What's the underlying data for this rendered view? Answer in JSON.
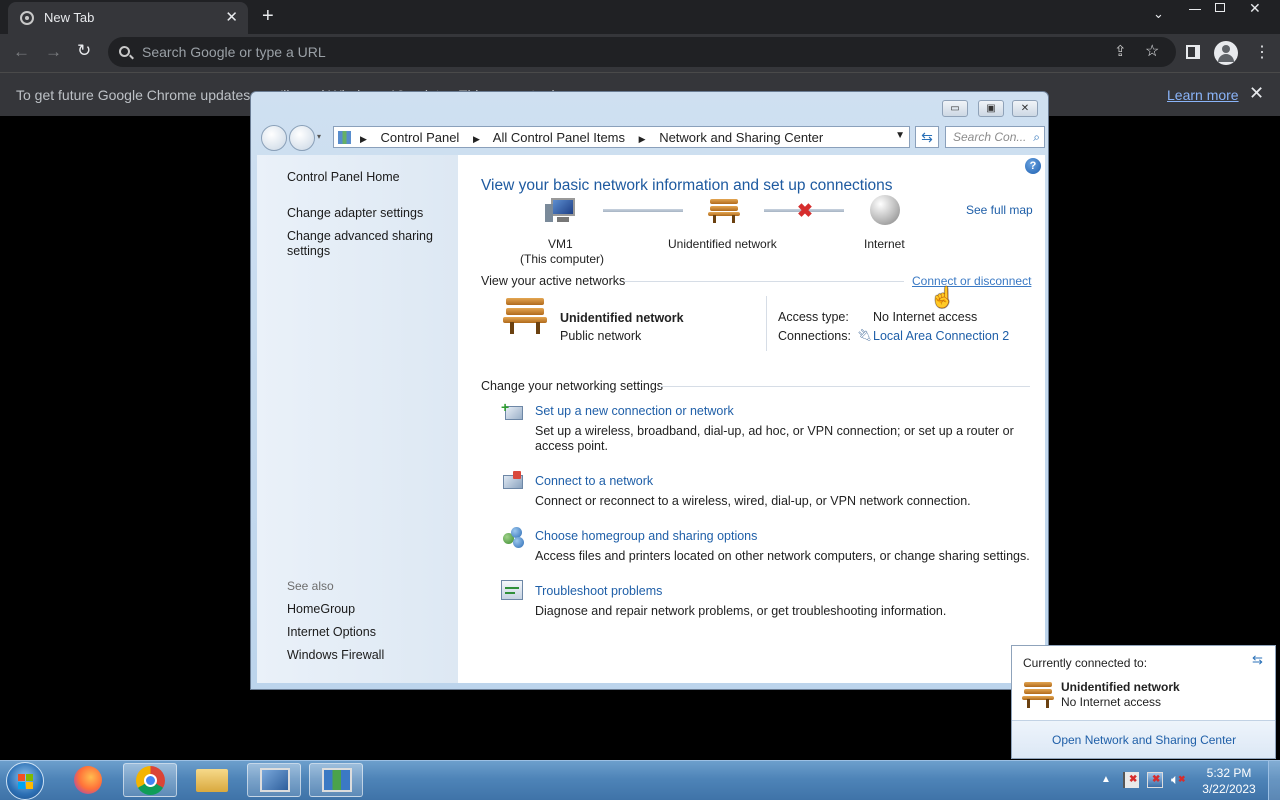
{
  "browser": {
    "tab_title": "New Tab",
    "omnibox_placeholder": "Search Google or type a URL",
    "infobar_message": "To get future Google Chrome updates, you'll need Windows 10 or later. This computer is using Windows 7.",
    "infobar_link": "Learn more"
  },
  "window": {
    "breadcrumbs": [
      "Control Panel",
      "All Control Panel Items",
      "Network and Sharing Center"
    ],
    "search_placeholder": "Search Con..."
  },
  "sidebar": {
    "home": "Control Panel Home",
    "links": [
      "Change adapter settings",
      "Change advanced sharing settings"
    ],
    "see_also_label": "See also",
    "see_also": [
      "HomeGroup",
      "Internet Options",
      "Windows Firewall"
    ]
  },
  "main": {
    "heading": "View your basic network information and set up connections",
    "see_full_map": "See full map",
    "map": {
      "computer_name": "VM1",
      "computer_sub": "(This computer)",
      "network": "Unidentified network",
      "internet": "Internet"
    },
    "active_networks_label": "View your active networks",
    "connect_link": "Connect or disconnect",
    "active": {
      "name": "Unidentified network",
      "type": "Public network",
      "access_label": "Access type:",
      "access_value": "No Internet access",
      "connections_label": "Connections:",
      "connections_value": "Local Area Connection 2"
    },
    "change_label": "Change your networking settings",
    "tasks": [
      {
        "title": "Set up a new connection or network",
        "desc": "Set up a wireless, broadband, dial-up, ad hoc, or VPN connection; or set up a router or access point."
      },
      {
        "title": "Connect to a network",
        "desc": "Connect or reconnect to a wireless, wired, dial-up, or VPN network connection."
      },
      {
        "title": "Choose homegroup and sharing options",
        "desc": "Access files and printers located on other network computers, or change sharing settings."
      },
      {
        "title": "Troubleshoot problems",
        "desc": "Diagnose and repair network problems, or get troubleshooting information."
      }
    ]
  },
  "popup": {
    "header": "Currently connected to:",
    "network_name": "Unidentified network",
    "network_status": "No Internet access",
    "footer_link": "Open Network and Sharing Center"
  },
  "taskbar": {
    "time": "5:32 PM",
    "date": "3/22/2023"
  },
  "colors": {
    "link": "#1f5fa8",
    "heading": "#1e5aa0",
    "error_x": "#d62d2d"
  }
}
